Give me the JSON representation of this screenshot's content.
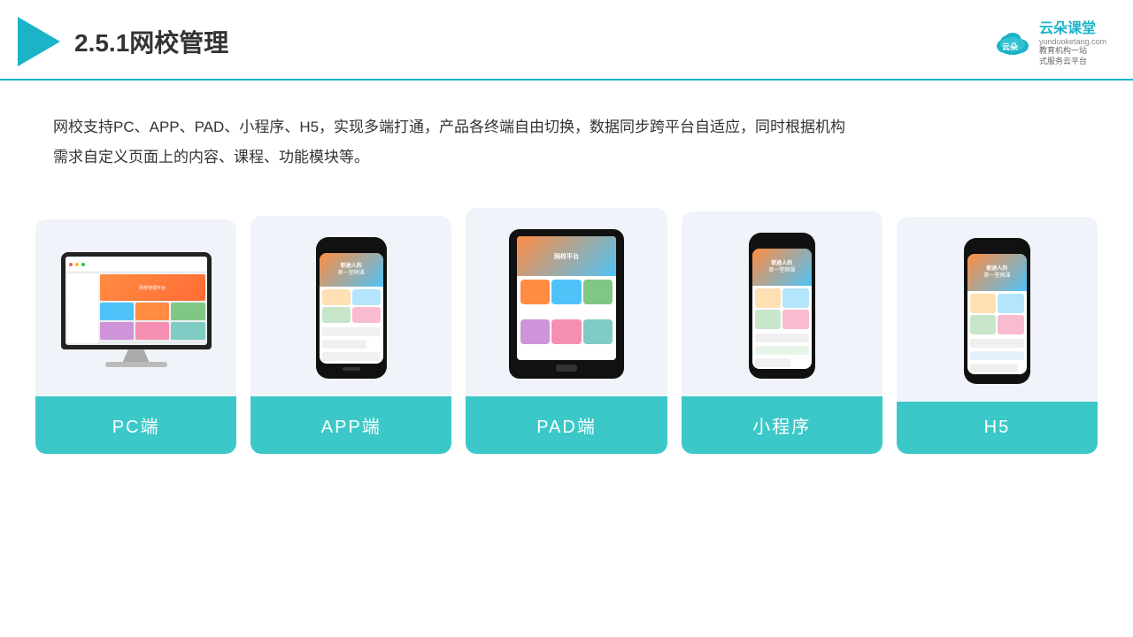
{
  "header": {
    "title": "2.5.1网校管理",
    "brand": {
      "name": "云朵课堂",
      "url": "yunduoketang.com",
      "sub1": "教育机构一站",
      "sub2": "式服务云平台"
    }
  },
  "description": {
    "text": "网校支持PC、APP、PAD、小程序、H5，实现多端打通，产品各终端自由切换，数据同步跨平台自适应，同时根据机构需求自定义页面上的内容、课程、功能模块等。"
  },
  "cards": [
    {
      "id": "pc",
      "label": "PC端"
    },
    {
      "id": "app",
      "label": "APP端"
    },
    {
      "id": "pad",
      "label": "PAD端"
    },
    {
      "id": "mini",
      "label": "小程序"
    },
    {
      "id": "h5",
      "label": "H5"
    }
  ],
  "colors": {
    "teal": "#3cc8c8",
    "brand": "#1ab3c8",
    "card_bg": "#f0f4fa"
  }
}
